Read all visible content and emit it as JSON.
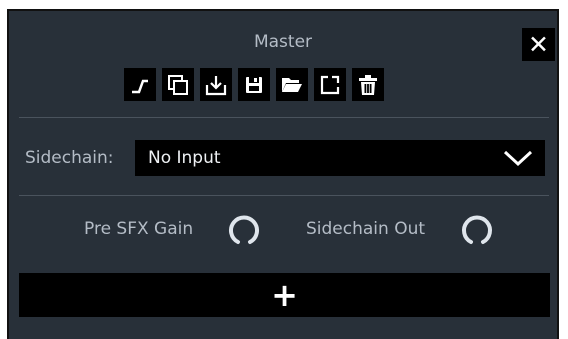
{
  "header": {
    "title": "Master",
    "close_label": "✕"
  },
  "toolbar": {
    "buttons": [
      {
        "name": "bypass-icon"
      },
      {
        "name": "duplicate-icon"
      },
      {
        "name": "import-icon"
      },
      {
        "name": "save-icon"
      },
      {
        "name": "open-folder-icon"
      },
      {
        "name": "pop-out-icon"
      },
      {
        "name": "delete-icon"
      }
    ]
  },
  "sidechain": {
    "label": "Sidechain:",
    "value": "No Input",
    "chevron": "chevron-down-icon"
  },
  "knobs": [
    {
      "label": "Pre SFX Gain"
    },
    {
      "label": "Sidechain Out"
    }
  ],
  "add_button": {
    "label": "+"
  },
  "colors": {
    "panel_bg": "#283039",
    "button_bg": "#000000",
    "label_text": "#b4bcc6",
    "value_text": "#eef1f4",
    "divider": "#4a535d"
  }
}
